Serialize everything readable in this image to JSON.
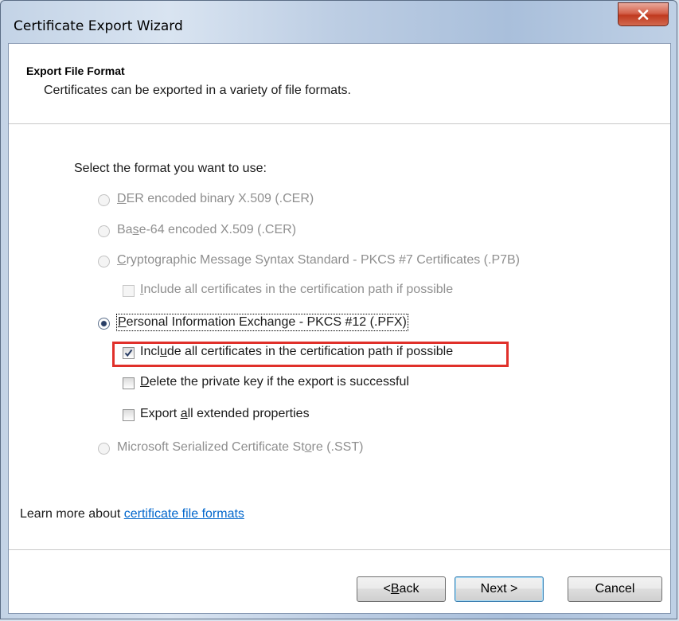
{
  "window": {
    "title": "Certificate Export Wizard"
  },
  "header": {
    "title": "Export File Format",
    "subtitle": "Certificates can be exported in a variety of file formats."
  },
  "prompt": "Select the format you want to use:",
  "options": {
    "der": {
      "pre": "",
      "key": "D",
      "post": "ER encoded binary X.509 (.CER)",
      "selected": false,
      "enabled": false
    },
    "b64": {
      "pre": "Ba",
      "key": "s",
      "post": "e-64 encoded X.509 (.CER)",
      "selected": false,
      "enabled": false
    },
    "p7b": {
      "pre": "",
      "key": "C",
      "post": "ryptographic Message Syntax Standard - PKCS #7 Certificates (.P7B)",
      "selected": false,
      "enabled": false
    },
    "p7b_include": {
      "pre": "",
      "key": "I",
      "post": "nclude all certificates in the certification path if possible",
      "checked": false,
      "enabled": false
    },
    "pfx": {
      "pre": "",
      "key": "P",
      "post": "ersonal Information Exchange - PKCS #12 (.PFX)",
      "selected": true,
      "enabled": true
    },
    "pfx_include": {
      "pre": "Incl",
      "key": "u",
      "post": "de all certificates in the certification path if possible",
      "checked": true,
      "enabled": true
    },
    "pfx_delete": {
      "pre": "",
      "key": "D",
      "post": "elete the private key if the export is successful",
      "checked": false,
      "enabled": true
    },
    "pfx_export": {
      "pre": "Export ",
      "key": "a",
      "post": "ll extended properties",
      "checked": false,
      "enabled": true
    },
    "sst": {
      "pre": "Microsoft Serialized Certificate St",
      "key": "o",
      "post": "re (.SST)",
      "selected": false,
      "enabled": false
    }
  },
  "learn_more": {
    "prefix": "Learn more about ",
    "link": "certificate file formats"
  },
  "buttons": {
    "back": {
      "pre": "< ",
      "key": "B",
      "post": "ack"
    },
    "next": "Next >",
    "cancel": "Cancel"
  },
  "colors": {
    "highlight": "#e0302a",
    "link": "#0066cc",
    "close": "#c03a1f"
  }
}
